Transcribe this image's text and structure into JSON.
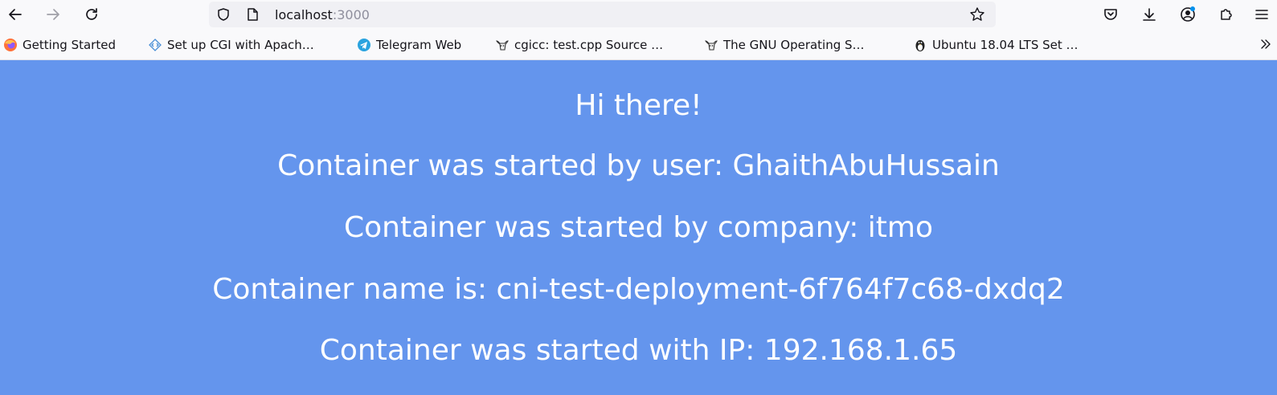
{
  "browser": {
    "url_host": "localhost",
    "url_port": ":3000",
    "icons": {
      "back": "back-arrow-icon",
      "forward": "forward-arrow-icon",
      "reload": "reload-icon",
      "shield": "tracking-protection-shield-icon",
      "page": "page-info-icon",
      "bookmark_star": "bookmark-star-icon",
      "pocket": "pocket-icon",
      "downloads": "downloads-icon",
      "account": "account-icon",
      "extensions": "extensions-icon",
      "menu": "hamburger-menu-icon",
      "overflow": "bookmarks-overflow-chevron-icon"
    }
  },
  "bookmarks": [
    {
      "label": "Getting Started",
      "icon": "firefox-icon"
    },
    {
      "label": "Set up CGI with Apach…",
      "icon": "code-tag-icon"
    },
    {
      "label": "Telegram Web",
      "icon": "telegram-icon"
    },
    {
      "label": "cgicc: test.cpp Source …",
      "icon": "gnu-icon"
    },
    {
      "label": "The GNU Operating S…",
      "icon": "gnu-icon"
    },
    {
      "label": "Ubuntu 18.04 LTS Set …",
      "icon": "linux-penguin-icon"
    }
  ],
  "page": {
    "greeting": "Hi there!",
    "user_line": "Container was started by user: GhaithAbuHussain",
    "company_line": "Container was started by company: itmo",
    "name_line": "Container name is: cni-test-deployment-6f764f7c68-dxdq2",
    "ip_line": "Container was started with IP: 192.168.1.65"
  },
  "colors": {
    "page_background": "#6495ED",
    "page_text": "#FFFFFF",
    "toolbar_background": "#F9F9FB",
    "urlbar_background": "#F0F0F4"
  }
}
